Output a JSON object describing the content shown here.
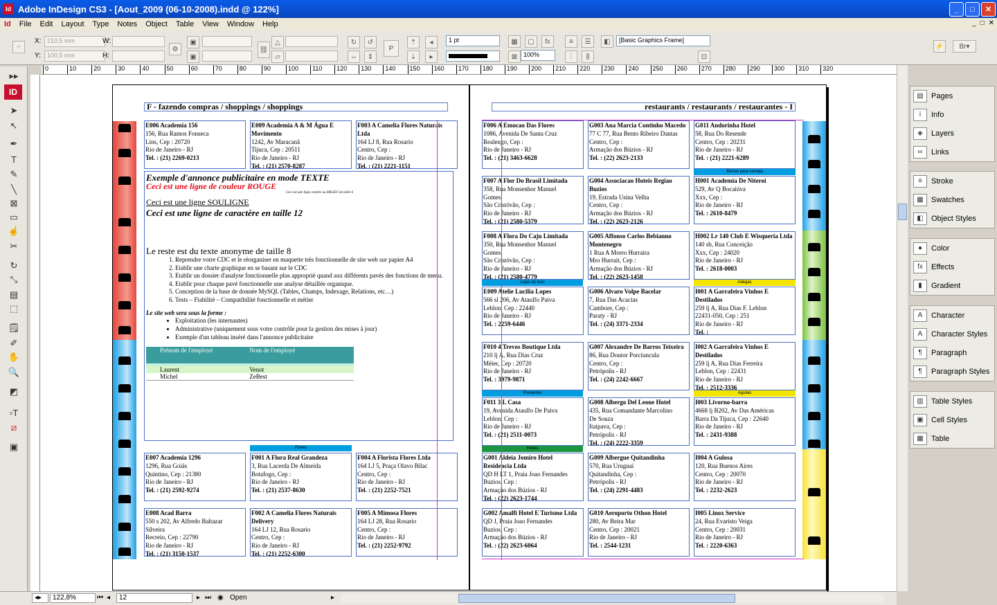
{
  "window": {
    "title": "Adobe InDesign CS3 - [Aout_2009 (06-10-2008).indd @ 122%]"
  },
  "menu": [
    "File",
    "Edit",
    "Layout",
    "Type",
    "Notes",
    "Object",
    "Table",
    "View",
    "Window",
    "Help"
  ],
  "control": {
    "x_label": "X:",
    "x_value": "210,5 mm",
    "y_label": "Y:",
    "y_value": "100,5 mm",
    "w_label": "W:",
    "h_label": "H:",
    "stroke_weight": "1 pt",
    "zoom_pct": "100%",
    "frame_style": "[Basic Graphics Frame]"
  },
  "ruler_ticks": [
    "0",
    "10",
    "20",
    "30",
    "40",
    "50",
    "60",
    "70",
    "80",
    "90",
    "100",
    "110",
    "120",
    "130",
    "140",
    "150",
    "160",
    "170",
    "180",
    "190",
    "200",
    "210",
    "220",
    "230",
    "240",
    "250",
    "260",
    "270",
    "280",
    "290",
    "300",
    "310",
    "320"
  ],
  "panels": [
    [
      "Pages",
      "Info",
      "Layers",
      "Links"
    ],
    [
      "Stroke",
      "Swatches",
      "Object Styles"
    ],
    [
      "Color",
      "Effects",
      "Gradient"
    ],
    [
      "Character",
      "Character Styles",
      "Paragraph",
      "Paragraph Styles"
    ],
    [
      "Table Styles",
      "Cell Styles",
      "Table"
    ]
  ],
  "panel_icons": [
    "pages-icon",
    "info-icon",
    "layers-icon",
    "links-icon",
    "stroke-icon",
    "swatches-icon",
    "object-styles-icon",
    "color-icon",
    "effects-icon",
    "gradient-icon",
    "character-icon",
    "character-styles-icon",
    "paragraph-icon",
    "paragraph-styles-icon",
    "table-styles-icon",
    "cell-styles-icon",
    "table-icon"
  ],
  "status": {
    "zoom": "122,8%",
    "page": "12",
    "state": "Open"
  },
  "left_page": {
    "header": "F  -  fazendo compras / shoppings / shoppings",
    "top_cards": [
      {
        "title": "E006  Academia 156",
        "lines": [
          "156, Rua Ramos Fonseca",
          "Lins, Cep : 20720",
          "Rio de Janeiro - RJ"
        ],
        "tel": "Tel. : (21) 2269-0213"
      },
      {
        "title": "E009  Academia A & M Água E Movimento",
        "lines": [
          "1242, Av Maracanã",
          "Tijuca, Cep : 20511",
          "Rio de Janeiro - RJ"
        ],
        "tel": "Tel. : (21) 2570-8287"
      },
      {
        "title": "F003  A Camelia Flores Naturais Ltda",
        "lines": [
          "164 LJ 8, Rua  Rosario",
          "Centro, Cep :",
          "Rio de Janeiro - RJ"
        ],
        "tel": "Tel. : (21) 2221-1151"
      }
    ],
    "ad": {
      "title": "Exemple d'annonce publicitaire en mode TEXTE",
      "red_line": "Ceci est une ligne de couleur ROUGE",
      "small_center": "Ceci est une ligne centrée au MILIEU de taille 6",
      "underline": "Ceci est une ligne SOULIGNE",
      "size12": "Ceci est une ligne de caractère en taille 12",
      "size8": "Le reste est du texte anonyme de taille 8",
      "numbered": [
        "Reprendre votre CDC et le réorganiser en maquette très fonctionnelle de site web sur papier A4",
        "Etablir une charte graphique en se basant sur le CDC",
        "Etablir un dossier d'analyse fonctionnelle plus approprié quand aux différents pavés des fonctions de menu.",
        "Etablir pour chaque pavé fonctionnelle une analyse détaillée organique.",
        "Conception de la base de donnée MySQL (Tables, Champs, Indexage, Relations, etc…)",
        "Tests – Fiabilité – Compatibilité fonctionnelle et métier"
      ],
      "form_line": "Le site web sera sous la forme :",
      "bullets": [
        "Exploitation (les internautes)",
        "Administrative  (uniquement sous votre contrôle pour la gestion des mises à jour)",
        "Exemple d'un tableau inséré dans l'annonce publicitaire"
      ],
      "table": {
        "headers": [
          "Prénom de l'employé",
          "Nom de l'employé"
        ],
        "rows": [
          [
            "Laurent",
            "Venot"
          ],
          [
            "Michel",
            "ZeBest"
          ]
        ]
      }
    },
    "tag_flores": "Flores",
    "bottom_cards": [
      {
        "title": "E007  Academia 1296",
        "lines": [
          "1296, Rua Goiás",
          "Quintino, Cep : 21380",
          "Rio de Janeiro - RJ"
        ],
        "tel": "Tel. : (21) 2592-9274"
      },
      {
        "title": "F001  A Flora Real Grandeza",
        "lines": [
          "3, Rua  Lacerda  De  Almeida",
          "Botafogo, Cep :",
          "Rio de Janeiro - RJ"
        ],
        "tel": "Tel. : (21) 2537-8630"
      },
      {
        "title": "F004  A Florista Flores Ltda",
        "lines": [
          "164  LJ  5, Praça  Olavo  Bilac",
          "Centro, Cep :",
          "Rio de Janeiro - RJ"
        ],
        "tel": "Tel. : (21) 2252-7521"
      },
      {
        "title": "E008  Acad Barra",
        "lines": [
          "550 s 202, Av Alfredo Baltazar",
          "Silveira",
          "Recreio, Cep : 22790",
          "Rio de Janeiro - RJ"
        ],
        "tel": "Tel. : (21) 3150-1537"
      },
      {
        "title": "F002  A Camelia Flores Naturais Delivery",
        "lines": [
          "164  LJ  12, Rua  Rosario",
          "Centro, Cep :",
          "Rio de Janeiro - RJ"
        ],
        "tel": "Tel. : (21) 2252-6300"
      },
      {
        "title": "F005  A Mimosa Flores",
        "lines": [
          "164 LJ 28, Rua Rosario",
          "Centro, Cep :",
          "Rio de Janeiro - RJ"
        ],
        "tel": "Tel. : (21) 2252-9792"
      }
    ]
  },
  "right_page": {
    "header": "restaurants / restaurants / restaurantes  -  I",
    "cards": [
      {
        "title": "F006  A Emocao Das Flores",
        "lines": [
          "1086, Avenida  De  Santa  Cruz",
          "Realengo, Cep :",
          "Rio de Janeiro - RJ"
        ],
        "tel": "Tel. : (21) 3463-6628"
      },
      {
        "title": "G003  Ana Marcia Continho Macedo",
        "lines": [
          "77 C 77, Rua Bento Ribeiro Dantas",
          "Centro, Cep :",
          "Armação dos Búzios - RJ"
        ],
        "tel": "Tel. : (22) 2623-2133"
      },
      {
        "title": "G011  Andorinha Hotel",
        "lines": [
          "58, Rua Do Resende",
          "Centro, Cep : 20231",
          "Rio de Janeiro - RJ"
        ],
        "tel": "Tel. : (21) 2221-6289"
      },
      {
        "title": "F007  A Flor Do Brasil Limitada",
        "lines": [
          "358, Rua  Monsenhor  Manuel",
          "Gomes",
          "São Cristóvão, Cep :",
          "Rio de Janeiro - RJ"
        ],
        "tel": "Tel. : (21) 2580-5379"
      },
      {
        "title": "G004  Associacao Hoteis Regiao Buzios",
        "lines": [
          "19, Estrada Usina Velha",
          "Centro, Cep :",
          "Armação dos Búzios - RJ"
        ],
        "tel": "Tel. : (22) 2623-2126"
      },
      {
        "title": "H001  Academia De Niteroi",
        "lines": [
          "529, Av Q Bocaiúva",
          "Xxx, Cep :",
          "Rio de Janeiro - RJ"
        ],
        "tel": "Tel. : 2610-8479"
      },
      {
        "title": "F008  A Flora Do Caju Limitada",
        "lines": [
          "350, Rua  Monsenhor  Manuel",
          "Gomes",
          "São Cristóvão, Cep :",
          "Rio de Janeiro - RJ"
        ],
        "tel": "Tel. : (21) 2580-4779"
      },
      {
        "title": "G005  Affonso Carlos Bebianno Montenegro",
        "lines": [
          "1 Rua A Morro Hurraira",
          "Mro Hurrait, Cep :",
          "Armação dos Búzios - RJ"
        ],
        "tel": "Tel. : (22) 2623-1458"
      },
      {
        "title": "H002  Lr 140 Club E Wisqueria Ltda",
        "lines": [
          "140 sb, Rua Conceição",
          "Xxx, Cep : 24020",
          "Rio de Janeiro - RJ"
        ],
        "tel": "Tel. : 2618-0003"
      },
      {
        "title": "E009  Atelie Lucilia Lopes",
        "lines": [
          "566 sl 206, Av Ataulfo Paiva",
          "Leblon, Cep : 22440",
          "Rio de Janeiro - RJ"
        ],
        "tel": "Tel. : 2259-6446"
      },
      {
        "title": "G006  Alvaro Volpe Bacelar",
        "lines": [
          "7, Rua Das Acacias",
          "Cambore, Cep :",
          "Paraty - RJ"
        ],
        "tel": "Tel. : (24) 3371-2334"
      },
      {
        "title": "I001  A Garrafeira Vinhos E Destilados",
        "lines": [
          "259 lj A, Rua Dias F. Leblon",
          "22431-050, Cep :   251",
          "Rio de Janeiro - RJ"
        ],
        "tel": "Tel. :"
      },
      {
        "title": "F010  4 Trevos Boutique Ltda",
        "lines": [
          "210 lj A, Rua Dias Cruz",
          "Méier, Cep : 20720",
          "Rio de Janeiro - RJ"
        ],
        "tel": "Tel. : 3979-9871"
      },
      {
        "title": "G007  Alexandre De Barros Teixeira",
        "lines": [
          "86, Rua Doutor Porciuncula",
          "Centro, Cep :",
          "Petrópolis - RJ"
        ],
        "tel": "Tel. : (24) 2242-6667"
      },
      {
        "title": "I002  A Garrafeira Vinhos E Destilados",
        "lines": [
          "259 lj A, Rua Dias Ferreira",
          "Leblon, Cep : 22431",
          "Rio de Janeiro - RJ"
        ],
        "tel": "Tel. : 2512-3336"
      },
      {
        "title": "F011  3 L Casa",
        "lines": [
          "19, Avenida  Ataulfo  De  Paiva",
          "Leblon, Cep :",
          "Rio de Janeiro - RJ"
        ],
        "tel": "Tel. : (21) 2511-0073"
      },
      {
        "title": "G008  Albergo Del Leone Hotel",
        "lines": [
          "435, Rua Comandante Marcolino",
          "De Souza",
          "Itaipava, Cep :",
          "Petrópolis - RJ"
        ],
        "tel": "Tel. : (24) 2222-3359"
      },
      {
        "title": "I003  Livorno-barra",
        "lines": [
          "4668 lj B202, Av Das Américas",
          "Barra Da Tijuca, Cep : 22640",
          "Rio de Janeiro - RJ"
        ],
        "tel": "Tel. : 2431-9388"
      },
      {
        "title": "G001  Aldeia Jomiro Hotel Residencia Ltda",
        "lines": [
          "QD H LT 1, Praia Joao Fernandes",
          "Buzios, Cep :",
          "Armação dos Búzios - RJ"
        ],
        "tel": "Tel. : (22) 2623-1744"
      },
      {
        "title": "G009  Albergue Quitandinha",
        "lines": [
          "570, Rua Uruguai",
          "Quitandinha, Cep :",
          "Petrópolis - RJ"
        ],
        "tel": "Tel. : (24) 2291-4483"
      },
      {
        "title": "I004  A Gulosa",
        "lines": [
          "120, Rua Buenos Aires",
          "Centro, Cep : 20070",
          "Rio de Janeiro - RJ"
        ],
        "tel": "Tel. : 2232-2623"
      },
      {
        "title": "G002  Amalfi Hotel E Turismo Ltda",
        "lines": [
          "QD J, Praia Joao Fernandes",
          "Buzios, Cep :",
          "Armação dos Búzios - RJ"
        ],
        "tel": "Tel. : (22) 2623-6064"
      },
      {
        "title": "G010  Aeroporto Othon Hotel",
        "lines": [
          "280, Av Beira Mar",
          "Centro, Cep : 20021",
          "Rio de Janeiro - RJ"
        ],
        "tel": "Tel. : 2544-1231"
      },
      {
        "title": "I005  Linox Service",
        "lines": [
          "24, Rua Evaristo Veiga",
          "Centro, Cep : 20031",
          "Rio de Janeiro - RJ"
        ],
        "tel": "Tel. : 2220-6363"
      }
    ],
    "tags": [
      "Barras para cerveja",
      "Lojas de luxo",
      "Adegas",
      "Presentes",
      "Aguilas",
      "Hotels"
    ]
  },
  "colors": {
    "titlebar": "#0b50d6",
    "tag_blue": "#009ee0",
    "tag_yellow": "#f4e500",
    "tag_green": "#1a9641",
    "band_red": "#e8453c",
    "band_blue": "#1fa0e6",
    "band_green": "#7cc242",
    "band_yellow": "#f6e23a",
    "guide": "#d22ed2"
  }
}
